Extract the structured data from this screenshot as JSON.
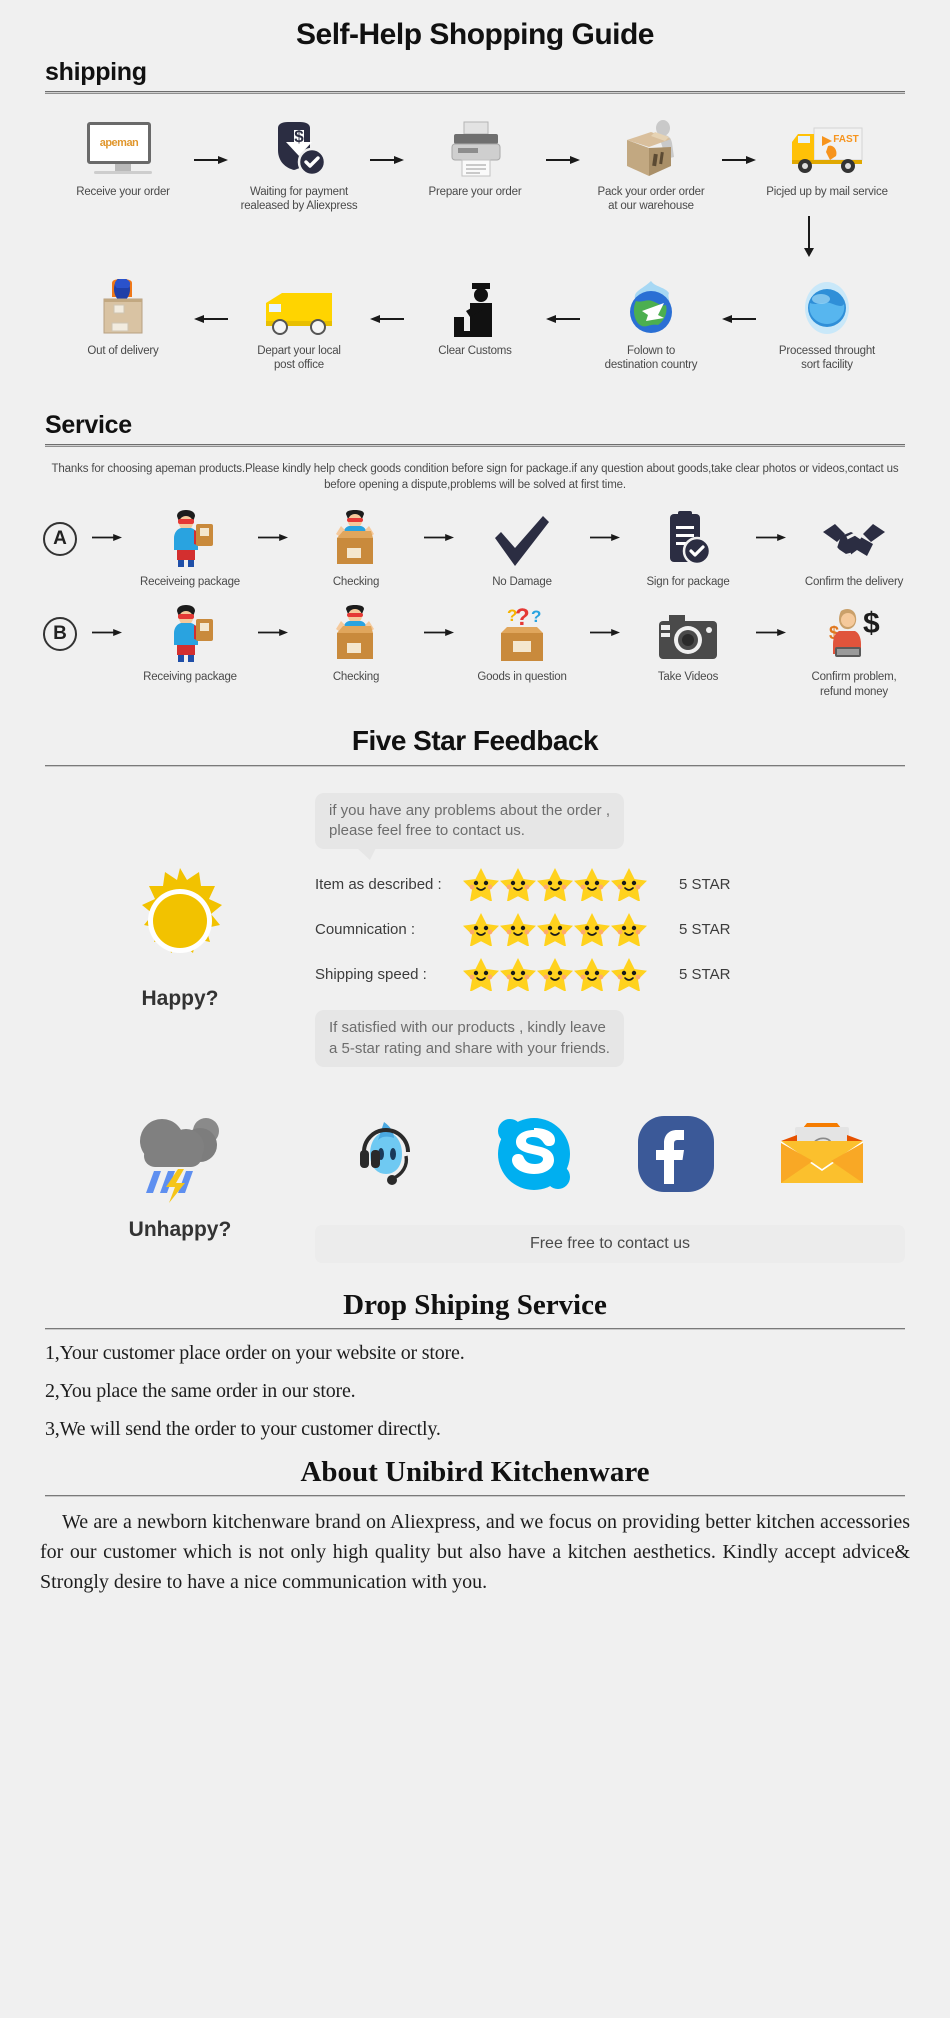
{
  "page": {
    "main_title": "Self-Help Shopping Guide",
    "background": "#f0f0f0"
  },
  "shipping": {
    "heading": "shipping",
    "row1": [
      {
        "label": "Receive your order",
        "icon": "monitor-apeman-icon"
      },
      {
        "label": "Waiting for payment\nrealeased by Aliexpress",
        "icon": "payment-shield-dollar-icon"
      },
      {
        "label": "Prepare your order",
        "icon": "printer-icon"
      },
      {
        "label": "Pack your order order\nat our warehouse",
        "icon": "packing-box-icon"
      },
      {
        "label": "Picjed up by mail service",
        "icon": "fast-delivery-truck-icon"
      }
    ],
    "row2": [
      {
        "label": "Out of delivery",
        "icon": "courier-with-box-icon"
      },
      {
        "label": "Depart your local\npost office",
        "icon": "yellow-van-icon"
      },
      {
        "label": "Clear Customs",
        "icon": "customs-officer-icon"
      },
      {
        "label": "Folown to\ndestination country",
        "icon": "globe-airplane-icon"
      },
      {
        "label": "Processed throught\nsort facility",
        "icon": "blue-globe-icon"
      }
    ]
  },
  "service": {
    "heading": "Service",
    "note": "Thanks for choosing apeman products.Please kindly help check goods condition before sign for package.if any question about goods,take clear photos or videos,contact us before opening a dispute,problems will be solved at first time.",
    "rowA": {
      "badge": "A",
      "steps": [
        {
          "label": "Receiveing package",
          "icon": "hero-holding-parcel-icon"
        },
        {
          "label": "Checking",
          "icon": "hero-in-open-box-icon"
        },
        {
          "label": "No Damage",
          "icon": "checkmark-icon"
        },
        {
          "label": "Sign for package",
          "icon": "signed-document-icon"
        },
        {
          "label": "Confirm the delivery",
          "icon": "handshake-icon"
        }
      ]
    },
    "rowB": {
      "badge": "B",
      "steps": [
        {
          "label": "Receiving package",
          "icon": "hero-holding-parcel-icon"
        },
        {
          "label": "Checking",
          "icon": "hero-in-open-box-icon"
        },
        {
          "label": "Goods in question",
          "icon": "box-question-marks-icon"
        },
        {
          "label": "Take Videos",
          "icon": "camera-icon"
        },
        {
          "label": "Confirm problem,\nrefund money",
          "icon": "support-agent-dollar-icon"
        }
      ]
    }
  },
  "feedback": {
    "heading": "Five Star Feedback",
    "happy_label": "Happy?",
    "bubble_top": "if you have any problems about the order ,\nplease feel free to contact us.",
    "ratings": [
      {
        "label": "Item as described :",
        "stars": 5,
        "value": "5 STAR"
      },
      {
        "label": "Coumnication :",
        "stars": 5,
        "value": "5 STAR"
      },
      {
        "label": "Shipping speed :",
        "stars": 5,
        "value": "5 STAR"
      }
    ],
    "bubble_bottom": "If satisfied with our products , kindly leave\na 5-star rating and share with your friends.",
    "unhappy_label": "Unhappy?",
    "contact_icons": [
      "qq-headset-mascot-icon",
      "skype-icon",
      "facebook-icon",
      "email-envelope-icon"
    ],
    "contact_bar": "Free free to contact us",
    "colors": {
      "star": "#FFD21E",
      "sun": "#F2C200",
      "skype": "#00AFF0",
      "facebook": "#3b5998",
      "envelope": "#FBC02D"
    }
  },
  "dropship": {
    "heading": "Drop Shiping Service",
    "items": [
      "1,Your customer place order on your website or store.",
      "2,You place the same order in our store.",
      "3,We will send the order to your customer directly."
    ]
  },
  "about": {
    "heading": "About Unibird Kitchenware",
    "body": "We are a newborn kitchenware brand on Aliexpress, and we focus on providing better kitchen accessories for our customer which is not only high quality but also have a kitchen aesthetics. Kindly accept advice& Strongly desire to have a nice communication with you."
  }
}
